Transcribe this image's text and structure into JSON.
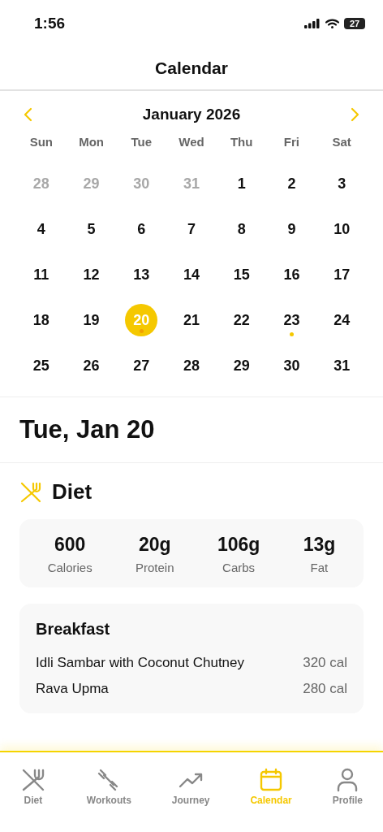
{
  "status_bar": {
    "time": "1:56",
    "battery": "27"
  },
  "header": {
    "title": "Calendar"
  },
  "calendar": {
    "month": "January 2026",
    "weekdays": [
      "Sun",
      "Mon",
      "Tue",
      "Wed",
      "Thu",
      "Fri",
      "Sat"
    ],
    "days": [
      {
        "label": "28",
        "outside": true,
        "selected": false,
        "has_entry": false
      },
      {
        "label": "29",
        "outside": true,
        "selected": false,
        "has_entry": false
      },
      {
        "label": "30",
        "outside": true,
        "selected": false,
        "has_entry": false
      },
      {
        "label": "31",
        "outside": true,
        "selected": false,
        "has_entry": false
      },
      {
        "label": "1",
        "outside": false,
        "selected": false,
        "has_entry": false
      },
      {
        "label": "2",
        "outside": false,
        "selected": false,
        "has_entry": false
      },
      {
        "label": "3",
        "outside": false,
        "selected": false,
        "has_entry": false
      },
      {
        "label": "4",
        "outside": false,
        "selected": false,
        "has_entry": false
      },
      {
        "label": "5",
        "outside": false,
        "selected": false,
        "has_entry": false
      },
      {
        "label": "6",
        "outside": false,
        "selected": false,
        "has_entry": false
      },
      {
        "label": "7",
        "outside": false,
        "selected": false,
        "has_entry": false
      },
      {
        "label": "8",
        "outside": false,
        "selected": false,
        "has_entry": false
      },
      {
        "label": "9",
        "outside": false,
        "selected": false,
        "has_entry": false
      },
      {
        "label": "10",
        "outside": false,
        "selected": false,
        "has_entry": false
      },
      {
        "label": "11",
        "outside": false,
        "selected": false,
        "has_entry": false
      },
      {
        "label": "12",
        "outside": false,
        "selected": false,
        "has_entry": false
      },
      {
        "label": "13",
        "outside": false,
        "selected": false,
        "has_entry": false
      },
      {
        "label": "14",
        "outside": false,
        "selected": false,
        "has_entry": false
      },
      {
        "label": "15",
        "outside": false,
        "selected": false,
        "has_entry": false
      },
      {
        "label": "16",
        "outside": false,
        "selected": false,
        "has_entry": false
      },
      {
        "label": "17",
        "outside": false,
        "selected": false,
        "has_entry": false
      },
      {
        "label": "18",
        "outside": false,
        "selected": false,
        "has_entry": false
      },
      {
        "label": "19",
        "outside": false,
        "selected": false,
        "has_entry": false
      },
      {
        "label": "20",
        "outside": false,
        "selected": true,
        "has_entry": true
      },
      {
        "label": "21",
        "outside": false,
        "selected": false,
        "has_entry": false
      },
      {
        "label": "22",
        "outside": false,
        "selected": false,
        "has_entry": false
      },
      {
        "label": "23",
        "outside": false,
        "selected": false,
        "has_entry": true
      },
      {
        "label": "24",
        "outside": false,
        "selected": false,
        "has_entry": false
      },
      {
        "label": "25",
        "outside": false,
        "selected": false,
        "has_entry": false
      },
      {
        "label": "26",
        "outside": false,
        "selected": false,
        "has_entry": false
      },
      {
        "label": "27",
        "outside": false,
        "selected": false,
        "has_entry": false
      },
      {
        "label": "28",
        "outside": false,
        "selected": false,
        "has_entry": false
      },
      {
        "label": "29",
        "outside": false,
        "selected": false,
        "has_entry": false
      },
      {
        "label": "30",
        "outside": false,
        "selected": false,
        "has_entry": false
      },
      {
        "label": "31",
        "outside": false,
        "selected": false,
        "has_entry": false
      }
    ]
  },
  "selected_date": "Tue, Jan 20",
  "diet": {
    "title": "Diet",
    "macros": [
      {
        "value": "600",
        "label": "Calories"
      },
      {
        "value": "20g",
        "label": "Protein"
      },
      {
        "value": "106g",
        "label": "Carbs"
      },
      {
        "value": "13g",
        "label": "Fat"
      }
    ],
    "meals": [
      {
        "title": "Breakfast",
        "items": [
          {
            "name": "Idli Sambar with Coconut Chutney",
            "calories": "320 cal"
          },
          {
            "name": "Rava Upma",
            "calories": "280 cal"
          }
        ]
      }
    ]
  },
  "tab_bar": [
    {
      "label": "Diet",
      "kind": "diet",
      "selected": false
    },
    {
      "label": "Workouts",
      "kind": "workouts",
      "selected": false
    },
    {
      "label": "Journey",
      "kind": "journey",
      "selected": false
    },
    {
      "label": "Calendar",
      "kind": "calendar",
      "selected": true
    },
    {
      "label": "Profile",
      "kind": "profile",
      "selected": false
    }
  ]
}
